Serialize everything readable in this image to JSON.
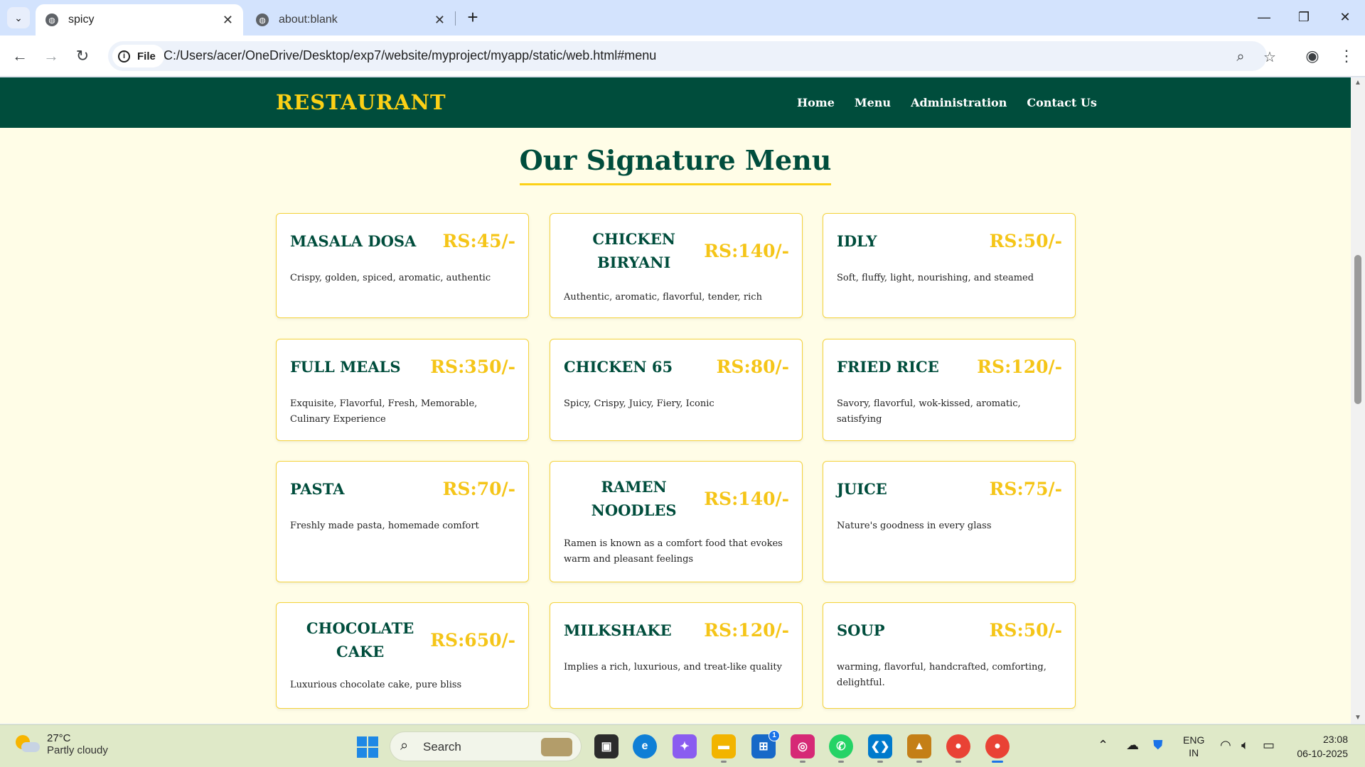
{
  "browser": {
    "tabs": [
      {
        "title": "spicy",
        "active": true
      },
      {
        "title": "about:blank",
        "active": false
      }
    ],
    "new_tab_label": "+",
    "address_chip": "File",
    "url": "C:/Users/acer/OneDrive/Desktop/exp7/website/myproject/myapp/static/web.html#menu"
  },
  "site": {
    "logo": "RESTAURANT",
    "nav": [
      "Home",
      "Menu",
      "Administration",
      "Contact Us"
    ],
    "section_title": "Our Signature Menu",
    "menu": [
      {
        "name": "MASALA DOSA",
        "price": "RS:45/-",
        "desc": "Crispy, golden, spiced, aromatic, authentic"
      },
      {
        "name": "CHICKEN BIRYANI",
        "price": "RS:140/-",
        "desc": "Authentic, aromatic, flavorful, tender, rich"
      },
      {
        "name": "IDLY",
        "price": "RS:50/-",
        "desc": "Soft, fluffy, light, nourishing, and steamed"
      },
      {
        "name": "FULL MEALS",
        "price": "RS:350/-",
        "desc": "Exquisite, Flavorful, Fresh, Memorable, Culinary Experience"
      },
      {
        "name": "CHICKEN 65",
        "price": "RS:80/-",
        "desc": "Spicy, Crispy, Juicy, Fiery, Iconic"
      },
      {
        "name": "FRIED RICE",
        "price": "RS:120/-",
        "desc": "Savory, flavorful, wok-kissed, aromatic, satisfying"
      },
      {
        "name": "PASTA",
        "price": "RS:70/-",
        "desc": "Freshly made pasta, homemade comfort"
      },
      {
        "name": "RAMEN NOODLES",
        "price": "RS:140/-",
        "desc": "Ramen is known as a comfort food that evokes warm and pleasant feelings"
      },
      {
        "name": "JUICE",
        "price": "RS:75/-",
        "desc": "Nature's goodness in every glass"
      },
      {
        "name": "CHOCOLATE CAKE",
        "price": "RS:650/-",
        "desc": "Luxurious chocolate cake, pure bliss"
      },
      {
        "name": "MILKSHAKE",
        "price": "RS:120/-",
        "desc": "Implies a rich, luxurious, and treat-like quality"
      },
      {
        "name": "SOUP",
        "price": "RS:50/-",
        "desc": "warming, flavorful, handcrafted, comforting, delightful."
      }
    ]
  },
  "taskbar": {
    "weather_temp": "27°C",
    "weather_condition": "Partly cloudy",
    "search_label": "Search",
    "store_badge": "1",
    "lang_line1": "ENG",
    "lang_line2": "IN",
    "time": "23:08",
    "date": "06-10-2025"
  },
  "colors": {
    "header_green": "#004d3c",
    "accent_yellow": "#fcd116",
    "page_bg": "#fffde7",
    "price_yellow": "#f5c518"
  }
}
